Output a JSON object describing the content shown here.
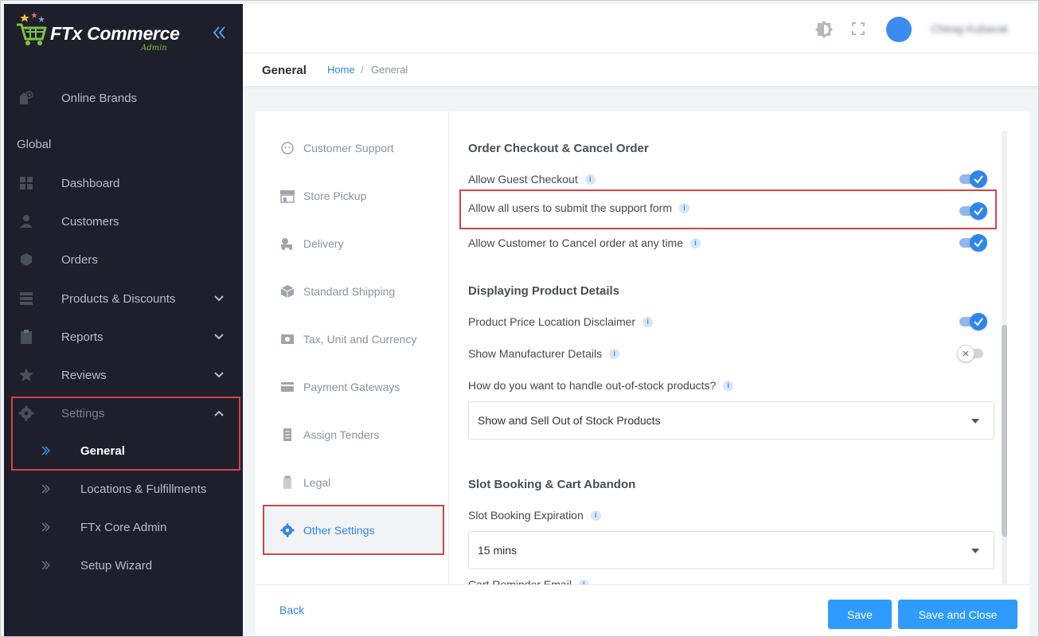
{
  "app": {
    "logo_text": "FTx Commerce",
    "logo_sub": "Admin",
    "user_name": "Chirag Kubavat"
  },
  "sidebar": {
    "top_item": {
      "label": "Online Brands",
      "icon": "store-icon"
    },
    "section_label": "Global",
    "items": [
      {
        "label": "Dashboard",
        "icon": "dashboard-icon"
      },
      {
        "label": "Customers",
        "icon": "user-icon"
      },
      {
        "label": "Orders",
        "icon": "box-icon"
      },
      {
        "label": "Products & Discounts",
        "icon": "server-icon",
        "expandable": true
      },
      {
        "label": "Reports",
        "icon": "clipboard-icon",
        "expandable": true
      },
      {
        "label": "Reviews",
        "icon": "star-icon",
        "expandable": true
      },
      {
        "label": "Settings",
        "icon": "gear-icon",
        "expanded": true
      }
    ],
    "sub_items": [
      {
        "label": "General",
        "active": true
      },
      {
        "label": "Locations & Fulfillments"
      },
      {
        "label": "FTx Core Admin"
      },
      {
        "label": "Setup Wizard"
      }
    ]
  },
  "header": {
    "page_title": "General",
    "breadcrumb_home": "Home",
    "breadcrumb_sep": "/",
    "breadcrumb_current": "General"
  },
  "tabs": [
    {
      "label": "Customer Support",
      "icon": "face-icon"
    },
    {
      "label": "Store Pickup",
      "icon": "storefront-icon"
    },
    {
      "label": "Delivery",
      "icon": "delivery-icon"
    },
    {
      "label": "Standard Shipping",
      "icon": "package-icon"
    },
    {
      "label": "Tax, Unit and Currency",
      "icon": "money-icon"
    },
    {
      "label": "Payment Gateways",
      "icon": "card-icon"
    },
    {
      "label": "Assign Tenders",
      "icon": "list-icon"
    },
    {
      "label": "Legal",
      "icon": "document-icon"
    },
    {
      "label": "Other Settings",
      "icon": "gear-icon",
      "active": true
    }
  ],
  "content": {
    "section1_title": "Order Checkout & Cancel Order",
    "guest_checkout": {
      "label": "Allow Guest Checkout",
      "on": true
    },
    "support_form": {
      "label": "Allow all users to submit the support form",
      "on": true
    },
    "cancel_order": {
      "label": "Allow Customer to Cancel order at any time",
      "on": true
    },
    "section2_title": "Displaying Product Details",
    "price_disclaimer": {
      "label": "Product Price Location Disclaimer",
      "on": true
    },
    "manufacturer": {
      "label": "Show Manufacturer Details",
      "on": false
    },
    "out_of_stock_label": "How do you want to handle out-of-stock products?",
    "out_of_stock_value": "Show and Sell Out of Stock Products",
    "section3_title": "Slot Booking & Cart Abandon",
    "slot_label": "Slot Booking Expiration",
    "slot_value": "15 mins",
    "cart_reminder_label": "Cart Reminder Email",
    "info_glyph": "i"
  },
  "footer": {
    "back": "Back",
    "save": "Save",
    "save_close": "Save and Close"
  },
  "colors": {
    "accent": "#2f86e8",
    "sidebar_bg": "#1e1f2b",
    "highlight": "#d04545",
    "button": "#2e9bff"
  }
}
